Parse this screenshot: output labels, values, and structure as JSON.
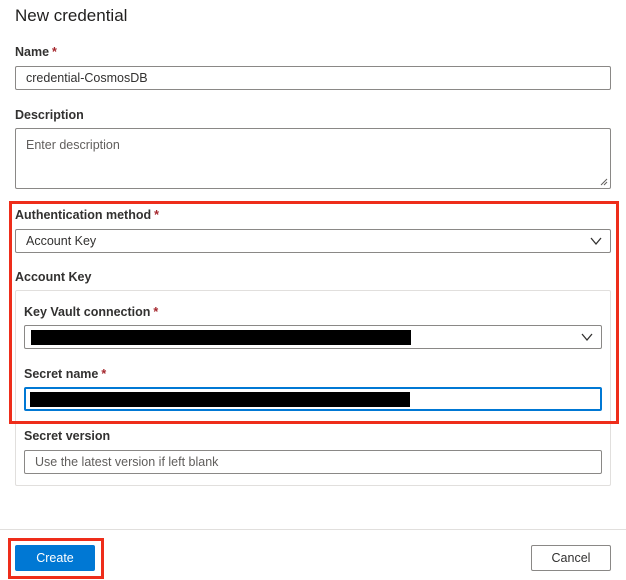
{
  "form": {
    "title": "New credential",
    "required_mark": "*",
    "name": {
      "label": "Name",
      "value": "credential-CosmosDB"
    },
    "description": {
      "label": "Description",
      "placeholder": "Enter description"
    },
    "auth_method": {
      "label": "Authentication method",
      "value": "Account Key"
    },
    "account_key_section": {
      "label": "Account Key"
    },
    "key_vault_connection": {
      "label": "Key Vault connection"
    },
    "secret_name": {
      "label": "Secret name"
    },
    "secret_version": {
      "label": "Secret version",
      "placeholder": "Use the latest version if left blank"
    }
  },
  "footer": {
    "create_label": "Create",
    "cancel_label": "Cancel"
  },
  "colors": {
    "primary": "#0078d4",
    "highlight": "#ee2d1a",
    "required": "#a4262c",
    "focus": "#0078d4"
  },
  "icons": {
    "dropdown": "chevron-down-icon",
    "resize": "resize-grip-icon"
  }
}
